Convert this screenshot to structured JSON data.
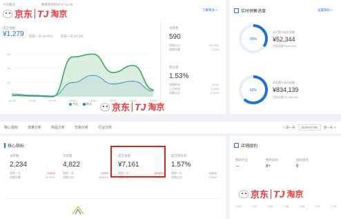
{
  "overview": {
    "tab_prefix": "今日概况",
    "mini_text": "数据更新时间 17:11:38",
    "more_link": "了解更多 >",
    "pay_amount": {
      "label": "成交金额",
      "value": "¥1,279",
      "sub1": "较前一天 65.07%",
      "sub2": "较前一天 ¥7,181"
    },
    "chart_ticks_y": [
      "60",
      "40",
      "20"
    ],
    "chart_ticks_x": [
      "00:00",
      "03:00",
      "06:00",
      "09:00",
      "12:00",
      "15:00",
      "18:00",
      "21:00"
    ],
    "legend": [
      {
        "name": "今天",
        "color": "#3aa757"
      },
      {
        "name": "昨天",
        "color": "#1e6fd9"
      }
    ],
    "visitors": {
      "label": "访客数",
      "value": "590",
      "row1_label": "同期占比",
      "row1_value": "92.03%",
      "row2_label": "同期访客",
      "row2_value": "2,234"
    },
    "conversion": {
      "label": "转化率",
      "value": "1.53%",
      "row1_label": "同期转化",
      "row1_value": "4.1%",
      "row2_label": "上月转化",
      "row2_value": "2.13%",
      "row3_label": "同期占比",
      "row3_value": "1.57%"
    }
  },
  "chart_data": {
    "type": "area",
    "x": [
      "00:00",
      "03:00",
      "06:00",
      "09:00",
      "12:00",
      "15:00",
      "18:00",
      "21:00"
    ],
    "series": [
      {
        "name": "今天",
        "values": [
          2,
          1,
          0,
          56,
          60,
          34,
          44,
          10
        ]
      },
      {
        "name": "昨天",
        "values": [
          4,
          2,
          1,
          20,
          30,
          18,
          22,
          8
        ]
      }
    ],
    "ylim": [
      0,
      70
    ]
  },
  "realtime": {
    "title": "实时销售进度",
    "settings_link": "设置目标 >",
    "month": {
      "percent": "35%",
      "label": "本月累计成交金额",
      "value": "¥52,344",
      "target": "目标金额 ¥150,000",
      "progress": 0.35
    },
    "year": {
      "percent": "62%",
      "label": "本年累计成交金额",
      "value": "¥834,139",
      "target": "目标金额 ¥1,340,000",
      "progress": 0.62
    }
  },
  "tabs": {
    "items": [
      "核心指标",
      "流量分析",
      "商品分析",
      "交易分析",
      "行业分析"
    ],
    "prev_label": "< 前一天",
    "date": "2018-07-08",
    "next_label": "后一天 >"
  },
  "core": {
    "title": "核心指标",
    "cards": [
      {
        "label": "访客数",
        "value": "2,234",
        "r1l": "较前一天",
        "r1v": "0.62%",
        "r2l": "同期访客",
        "r2v": "87.87%"
      },
      {
        "label": "浏览量",
        "value": "4,822",
        "r1l": "较前一天",
        "r1v": "0.99%",
        "r2l": "同期占比",
        "r2v": "86.64%"
      },
      {
        "label": "成交金额",
        "value": "¥7,161",
        "r1l": "较前一天",
        "r1v": "48.62%",
        "r2l": "同期占比",
        "r2v": "61.96%"
      },
      {
        "label": "成交转化率",
        "value": "1.57%",
        "r1l": "较前一天",
        "r1v": "3.50%",
        "r2l": "同期占比",
        "r2v": "1.63%"
      }
    ]
  },
  "shop": {
    "title": "店铺级别",
    "cols": [
      {
        "label": "我的行业",
        "value": "—"
      },
      {
        "label": "我的级别",
        "value": "8+"
      },
      {
        "label": "级别排名",
        "value": "9"
      }
    ],
    "x_ticks": [
      "7-02",
      "7-03",
      "7-04",
      "7-05",
      "7-06",
      "7-07",
      "7-08"
    ]
  },
  "watermark": {
    "jd": "京东",
    "tj": "TJ",
    "tb": "淘京"
  }
}
